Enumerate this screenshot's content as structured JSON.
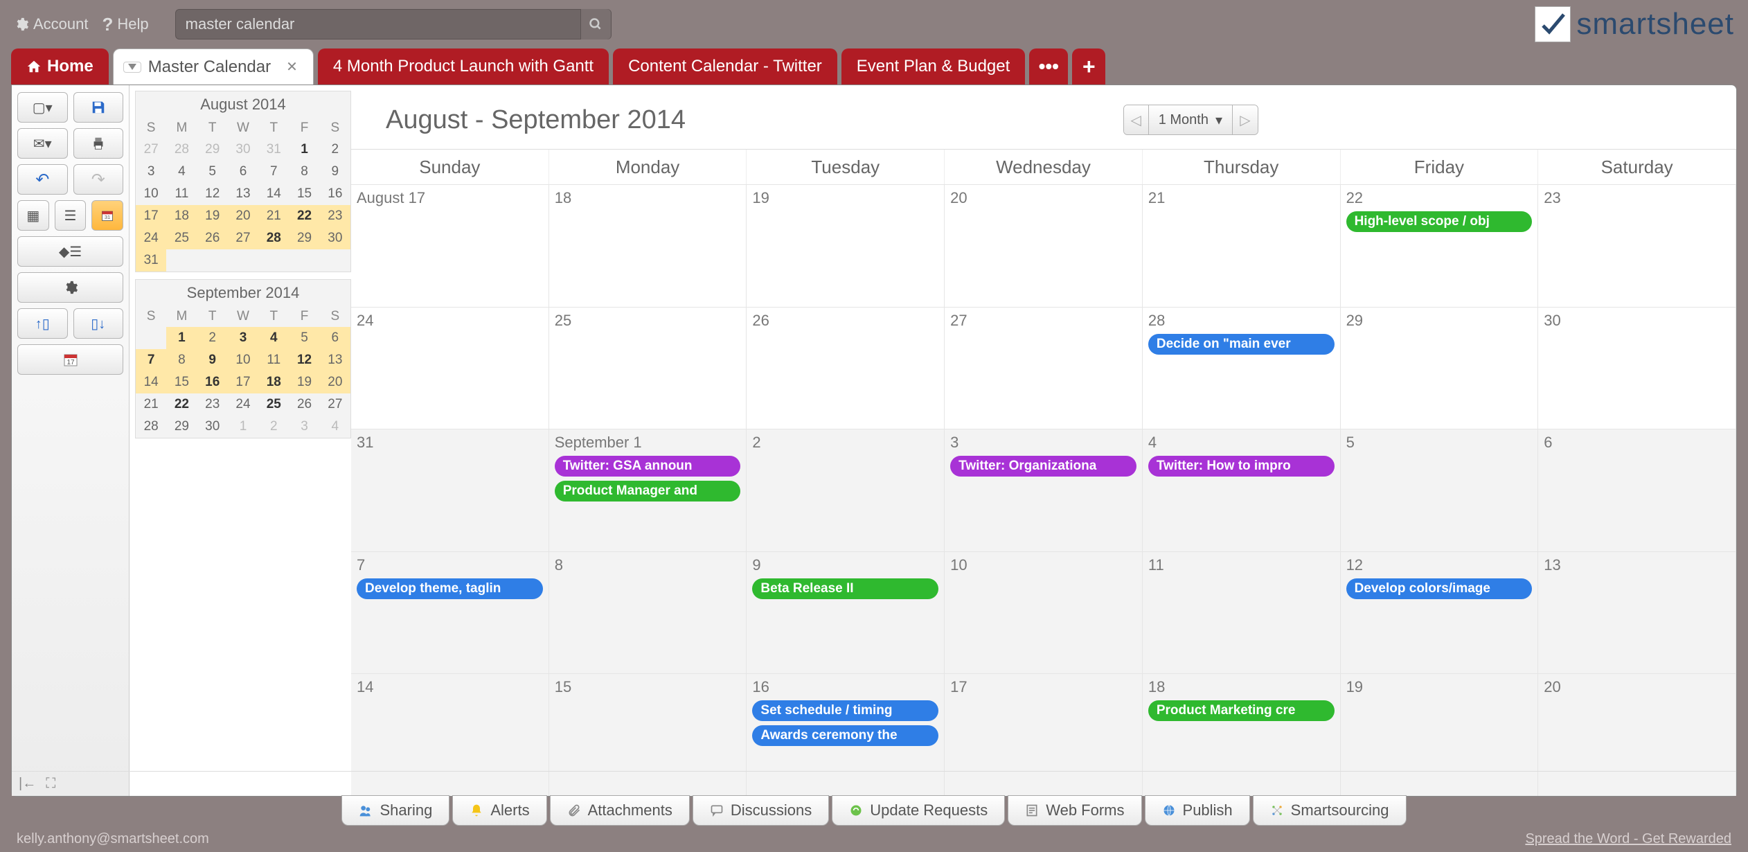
{
  "top": {
    "account": "Account",
    "help": "Help",
    "search_value": "master calendar"
  },
  "brand": "smartsheet",
  "tabs": {
    "home": "Home",
    "active": "Master Calendar",
    "others": [
      "4 Month Product Launch with Gantt",
      "Content Calendar - Twitter",
      "Event Plan & Budget"
    ]
  },
  "range": {
    "title": "August - September 2014",
    "span": "1 Month"
  },
  "mini": [
    {
      "title": "August 2014",
      "dow": [
        "S",
        "M",
        "T",
        "W",
        "T",
        "F",
        "S"
      ],
      "cells": [
        {
          "n": "27",
          "om": true
        },
        {
          "n": "28",
          "om": true
        },
        {
          "n": "29",
          "om": true
        },
        {
          "n": "30",
          "om": true
        },
        {
          "n": "31",
          "om": true
        },
        {
          "n": "1",
          "bold": true
        },
        {
          "n": "2"
        },
        {
          "n": "3"
        },
        {
          "n": "4"
        },
        {
          "n": "5"
        },
        {
          "n": "6"
        },
        {
          "n": "7"
        },
        {
          "n": "8"
        },
        {
          "n": "9"
        },
        {
          "n": "10"
        },
        {
          "n": "11"
        },
        {
          "n": "12"
        },
        {
          "n": "13"
        },
        {
          "n": "14"
        },
        {
          "n": "15"
        },
        {
          "n": "16"
        },
        {
          "n": "17",
          "hl": true
        },
        {
          "n": "18",
          "hl": true
        },
        {
          "n": "19",
          "hl": true
        },
        {
          "n": "20",
          "hl": true
        },
        {
          "n": "21",
          "hl": true
        },
        {
          "n": "22",
          "hl": true,
          "bold": true
        },
        {
          "n": "23",
          "hl": true
        },
        {
          "n": "24",
          "hl": true
        },
        {
          "n": "25",
          "hl": true
        },
        {
          "n": "26",
          "hl": true
        },
        {
          "n": "27",
          "hl": true
        },
        {
          "n": "28",
          "hl": true,
          "bold": true
        },
        {
          "n": "29",
          "hl": true
        },
        {
          "n": "30",
          "hl": true
        },
        {
          "n": "31",
          "hl": true
        },
        {
          "n": ""
        },
        {
          "n": ""
        },
        {
          "n": ""
        },
        {
          "n": ""
        },
        {
          "n": ""
        },
        {
          "n": ""
        }
      ]
    },
    {
      "title": "September 2014",
      "dow": [
        "S",
        "M",
        "T",
        "W",
        "T",
        "F",
        "S"
      ],
      "cells": [
        {
          "n": ""
        },
        {
          "n": "1",
          "hl": true,
          "bold": true
        },
        {
          "n": "2",
          "hl": true
        },
        {
          "n": "3",
          "hl": true,
          "bold": true
        },
        {
          "n": "4",
          "hl": true,
          "bold": true
        },
        {
          "n": "5",
          "hl": true
        },
        {
          "n": "6",
          "hl": true
        },
        {
          "n": "7",
          "hl": true,
          "bold": true
        },
        {
          "n": "8",
          "hl": true
        },
        {
          "n": "9",
          "hl": true,
          "bold": true
        },
        {
          "n": "10",
          "hl": true
        },
        {
          "n": "11",
          "hl": true
        },
        {
          "n": "12",
          "hl": true,
          "bold": true
        },
        {
          "n": "13",
          "hl": true
        },
        {
          "n": "14",
          "hl": true
        },
        {
          "n": "15",
          "hl": true
        },
        {
          "n": "16",
          "hl": true,
          "bold": true
        },
        {
          "n": "17",
          "hl": true
        },
        {
          "n": "18",
          "hl": true,
          "bold": true
        },
        {
          "n": "19",
          "hl": true
        },
        {
          "n": "20",
          "hl": true
        },
        {
          "n": "21"
        },
        {
          "n": "22",
          "bold": true
        },
        {
          "n": "23"
        },
        {
          "n": "24"
        },
        {
          "n": "25",
          "bold": true
        },
        {
          "n": "26"
        },
        {
          "n": "27"
        },
        {
          "n": "28"
        },
        {
          "n": "29"
        },
        {
          "n": "30"
        },
        {
          "n": "1",
          "om": true
        },
        {
          "n": "2",
          "om": true
        },
        {
          "n": "3",
          "om": true
        },
        {
          "n": "4",
          "om": true
        }
      ]
    }
  ],
  "dow": [
    "Sunday",
    "Monday",
    "Tuesday",
    "Wednesday",
    "Thursday",
    "Friday",
    "Saturday"
  ],
  "grid": [
    [
      {
        "label": "August 17"
      },
      {
        "label": "18"
      },
      {
        "label": "19"
      },
      {
        "label": "20"
      },
      {
        "label": "21"
      },
      {
        "label": "22",
        "events": [
          {
            "t": "High-level scope / obj",
            "c": "green"
          }
        ]
      },
      {
        "label": "23"
      }
    ],
    [
      {
        "label": "24"
      },
      {
        "label": "25"
      },
      {
        "label": "26"
      },
      {
        "label": "27"
      },
      {
        "label": "28",
        "events": [
          {
            "t": "Decide on \"main ever",
            "c": "blue"
          }
        ]
      },
      {
        "label": "29"
      },
      {
        "label": "30"
      }
    ],
    [
      {
        "label": "31",
        "shade": true
      },
      {
        "label": "September 1",
        "shade": true,
        "events": [
          {
            "t": "Twitter: GSA announ",
            "c": "purple"
          },
          {
            "t": "Product Manager and",
            "c": "green"
          }
        ]
      },
      {
        "label": "2",
        "shade": true
      },
      {
        "label": "3",
        "shade": true,
        "events": [
          {
            "t": "Twitter: Organizationa",
            "c": "purple"
          }
        ]
      },
      {
        "label": "4",
        "shade": true,
        "events": [
          {
            "t": "Twitter: How to impro",
            "c": "purple"
          }
        ]
      },
      {
        "label": "5",
        "shade": true
      },
      {
        "label": "6",
        "shade": true
      }
    ],
    [
      {
        "label": "7",
        "shade": true,
        "events": [
          {
            "t": "Develop theme, taglin",
            "c": "blue"
          }
        ]
      },
      {
        "label": "8",
        "shade": true
      },
      {
        "label": "9",
        "shade": true,
        "events": [
          {
            "t": "Beta Release II",
            "c": "green"
          }
        ]
      },
      {
        "label": "10",
        "shade": true
      },
      {
        "label": "11",
        "shade": true
      },
      {
        "label": "12",
        "shade": true,
        "events": [
          {
            "t": "Develop colors/image",
            "c": "blue"
          }
        ]
      },
      {
        "label": "13",
        "shade": true
      }
    ],
    [
      {
        "label": "14",
        "shade": true
      },
      {
        "label": "15",
        "shade": true
      },
      {
        "label": "16",
        "shade": true,
        "events": [
          {
            "t": "Set schedule / timing",
            "c": "blue"
          },
          {
            "t": "Awards ceremony the",
            "c": "blue"
          }
        ]
      },
      {
        "label": "17",
        "shade": true
      },
      {
        "label": "18",
        "shade": true,
        "events": [
          {
            "t": "Product Marketing cre",
            "c": "green"
          }
        ]
      },
      {
        "label": "19",
        "shade": true
      },
      {
        "label": "20",
        "shade": true
      }
    ]
  ],
  "footer_tabs": [
    "Sharing",
    "Alerts",
    "Attachments",
    "Discussions",
    "Update Requests",
    "Web Forms",
    "Publish",
    "Smartsourcing"
  ],
  "footer": {
    "email": "kelly.anthony@smartsheet.com",
    "promo": "Spread the Word - Get Rewarded"
  }
}
